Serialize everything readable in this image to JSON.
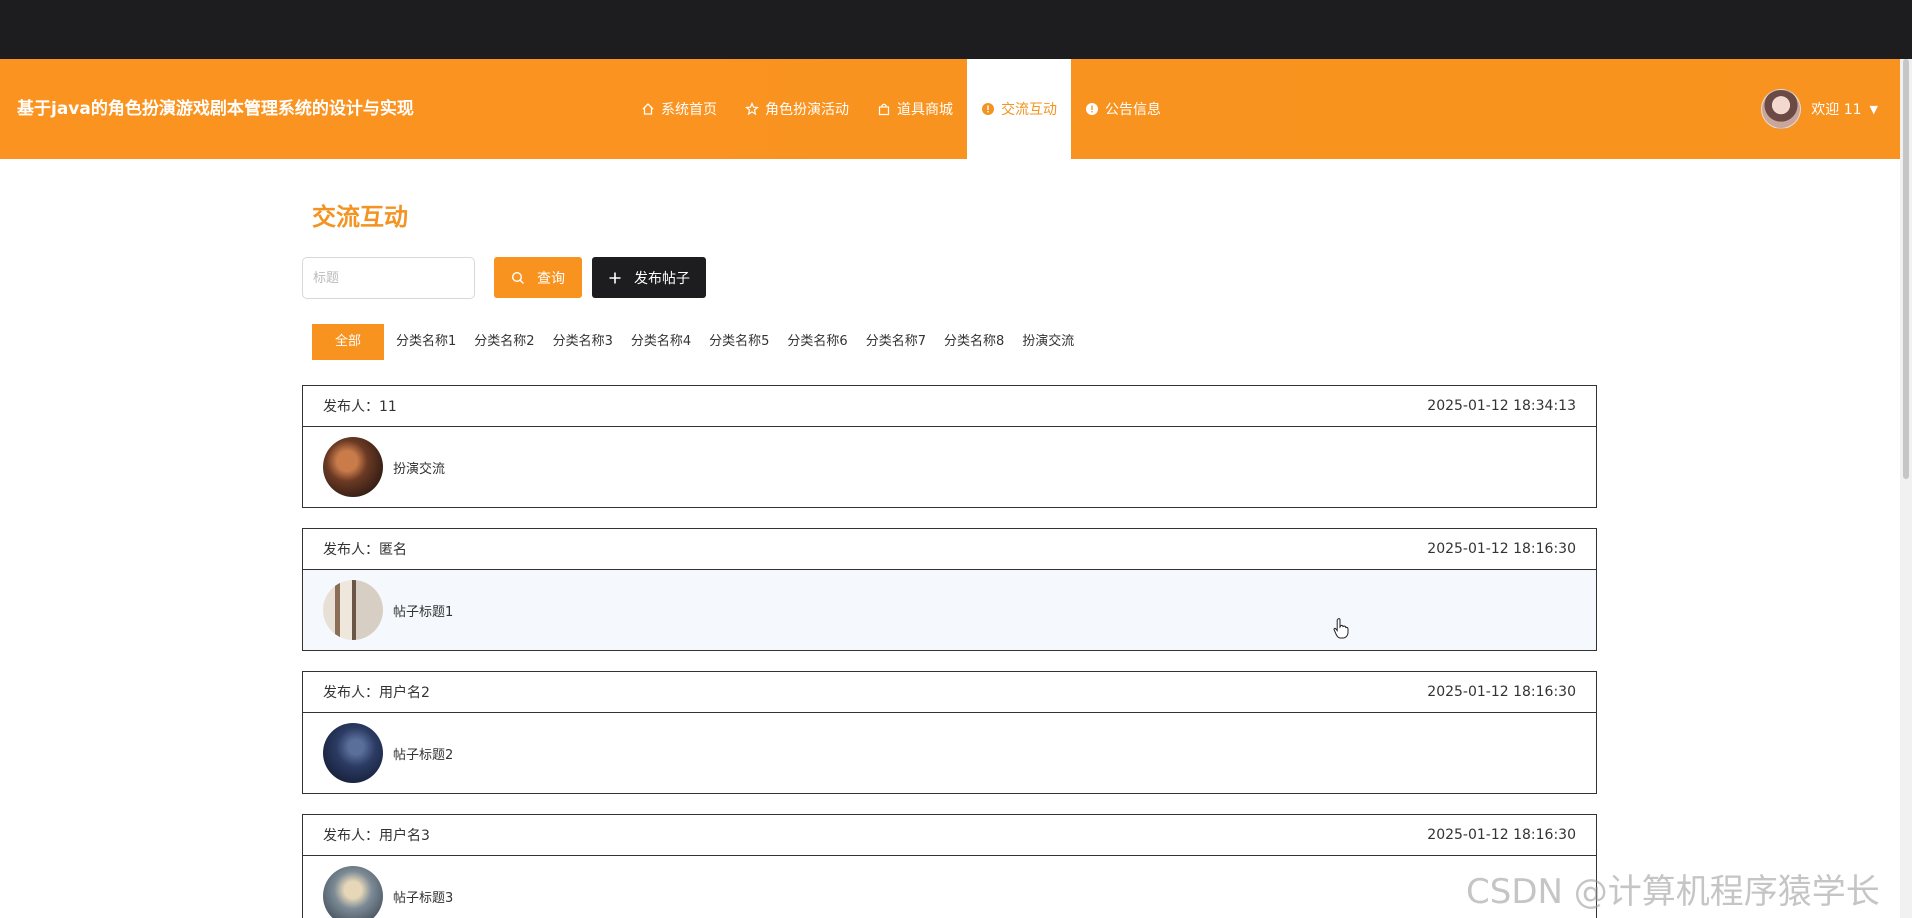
{
  "header": {
    "brand": "基于java的角色扮演游戏剧本管理系统的设计与实现",
    "nav": [
      {
        "label": "系统首页",
        "icon": "home-icon"
      },
      {
        "label": "角色扮演活动",
        "icon": "star-icon"
      },
      {
        "label": "道具商城",
        "icon": "bag-icon"
      },
      {
        "label": "交流互动",
        "icon": "info-circle-icon",
        "active": true
      },
      {
        "label": "公告信息",
        "icon": "info-circle-icon"
      }
    ],
    "user": {
      "welcome": "欢迎 11",
      "caret": "▼"
    }
  },
  "main": {
    "title": "交流互动",
    "search": {
      "placeholder": "标题",
      "value": ""
    },
    "query_label": "查询",
    "post_label": "发布帖子",
    "categories": [
      "全部",
      "分类名称1",
      "分类名称2",
      "分类名称3",
      "分类名称4",
      "分类名称5",
      "分类名称6",
      "分类名称7",
      "分类名称8",
      "扮演交流"
    ],
    "posts": [
      {
        "publisher": "发布人：11",
        "time": "2025-01-12 18:34:13",
        "title": "扮演交流"
      },
      {
        "publisher": "发布人：匿名",
        "time": "2025-01-12 18:16:30",
        "title": "帖子标题1"
      },
      {
        "publisher": "发布人：用户名2",
        "time": "2025-01-12 18:16:30",
        "title": "帖子标题2"
      },
      {
        "publisher": "发布人：用户名3",
        "time": "2025-01-12 18:16:30",
        "title": "帖子标题3"
      }
    ]
  },
  "watermark": "CSDN @计算机程序猿学长",
  "colors": {
    "accent": "#f7931e",
    "dark": "#1d1d1f"
  }
}
